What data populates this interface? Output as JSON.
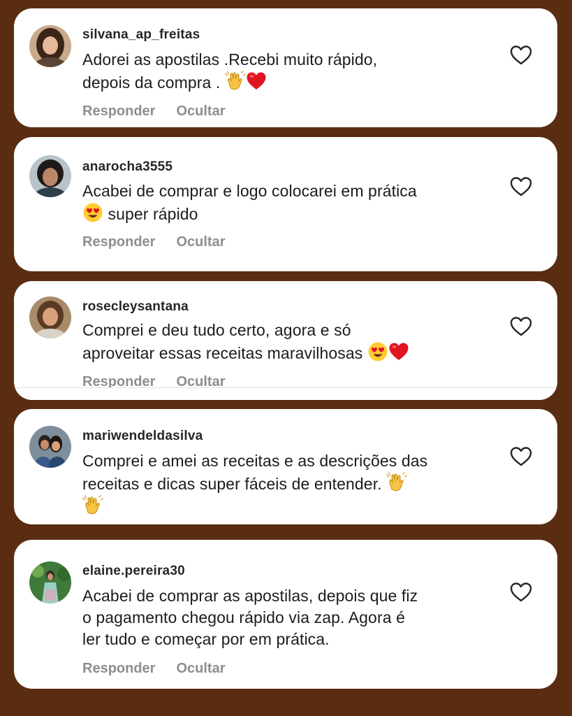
{
  "comments": [
    {
      "username": "silvana_ap_freitas",
      "text_line1": "Adorei as apostilas .Recebi muito rápido,",
      "text_line2": "depois da compra .",
      "emojis": [
        "clapping-hands",
        "red-heart"
      ],
      "reply_label": "Responder",
      "hide_label": "Ocultar"
    },
    {
      "username": "anarocha3555",
      "text_line1": "Acabei de comprar e logo colocarei em prática",
      "text_line2": "super rápido",
      "emojis": [
        "heart-eyes-face"
      ],
      "reply_label": "Responder",
      "hide_label": "Ocultar"
    },
    {
      "username": "rosecleysantana",
      "text_line1": "Comprei e deu tudo certo, agora e só",
      "text_line2": "aproveitar essas receitas maravilhosas",
      "emojis": [
        "heart-eyes-face",
        "red-heart"
      ],
      "reply_label": "Responder",
      "hide_label": "Ocultar"
    },
    {
      "username": "mariwendeldasilva",
      "text_line1": "Comprei e amei as receitas e as descrições das",
      "text_line2": "receitas e dicas super fáceis de entender.",
      "emojis": [
        "clapping-hands",
        "clapping-hands"
      ]
    },
    {
      "username": "elaine.pereira30",
      "text_line1": "Acabei de comprar as apostilas, depois que fiz",
      "text_line2": "o pagamento chegou rápido via zap. Agora é",
      "text_line3": "ler tudo e começar por em prática.",
      "reply_label": "Responder",
      "hide_label": "Ocultar"
    }
  ],
  "colors": {
    "background": "#5a2d12",
    "card": "#ffffff",
    "username": "#262626",
    "action_text": "#8e8e8e"
  }
}
